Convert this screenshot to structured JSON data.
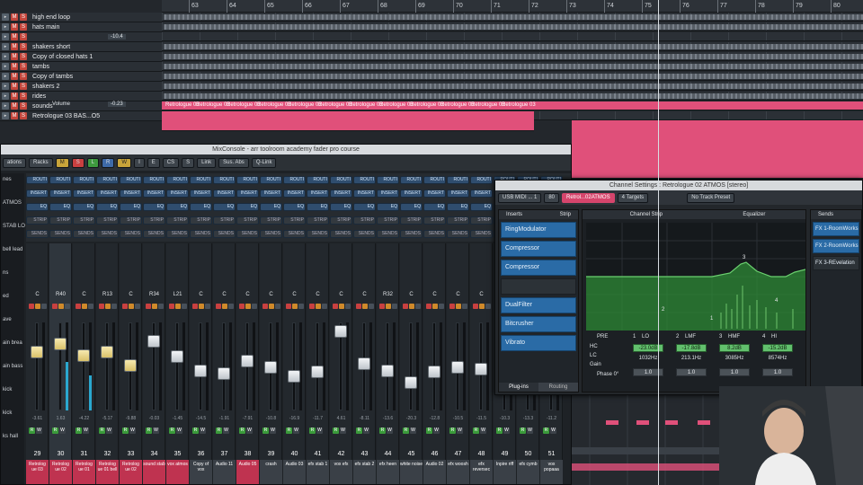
{
  "arrange": {
    "ruler_numbers": [
      "63",
      "64",
      "65",
      "66",
      "67",
      "68",
      "69",
      "70",
      "71",
      "72",
      "73",
      "74",
      "75",
      "76",
      "77",
      "78",
      "79",
      "80"
    ],
    "tracks": [
      {
        "name": "high end loop",
        "content": true
      },
      {
        "name": "hats main",
        "content": true
      },
      {
        "name": "",
        "content": false
      },
      {
        "name": "shakers short",
        "content": true
      },
      {
        "name": "Copy of closed hats 1",
        "content": true
      },
      {
        "name": "tambs",
        "content": true
      },
      {
        "name": "Copy of tambs",
        "content": true
      },
      {
        "name": "shakers 2",
        "content": true
      },
      {
        "name": "rides",
        "content": true
      },
      {
        "name": "sounds",
        "content": false
      },
      {
        "name": "Retrologue 03 BAS...O5",
        "content": false
      }
    ],
    "track_value_1": "-10.4",
    "track_value_2": "-0.23",
    "volume_label": "Volume",
    "part_label": "Retrologue 03"
  },
  "mixconsole": {
    "title": "MixConsole - arr toolroom academy fader pro course",
    "toolbar": [
      "ations",
      "Racks",
      "M",
      "S",
      "L",
      "R",
      "W",
      "I",
      "E",
      "CS",
      "S",
      "Link",
      "Sus. Abs",
      "Q-Link"
    ],
    "rack_rows": [
      "ROUTI",
      "INSERT",
      "EQ",
      "STRIP",
      "SENDS"
    ],
    "left_labels": [
      "nes",
      "ATMOS",
      "STAB LO",
      "bell lead",
      "ns",
      "ed",
      "ave",
      "ain brea",
      "ain bass",
      "kick",
      "kick",
      "ks hall"
    ],
    "strips": [
      {
        "label": "C",
        "num": "29",
        "name": "Retrolog ue 03",
        "val": "-3.61",
        "fader": 0.3,
        "meter": 0,
        "sel": false
      },
      {
        "label": "R40",
        "num": "30",
        "name": "Retrolog ue 02",
        "val": "1.63",
        "fader": 0.2,
        "meter": 0.55,
        "sel": true
      },
      {
        "label": "C",
        "num": "31",
        "name": "Retrolog ue 01",
        "val": "-4.22",
        "fader": 0.35,
        "meter": 0.4,
        "sel": false
      },
      {
        "label": "R13",
        "num": "32",
        "name": "Retrolog ue 01 bell",
        "val": "-5.17",
        "fader": 0.3,
        "meter": 0,
        "sel": false
      },
      {
        "label": "C",
        "num": "33",
        "name": "Retrolog ue 02",
        "val": "-9.88",
        "fader": 0.48,
        "meter": 0,
        "sel": false
      },
      {
        "label": "R34",
        "num": "34",
        "name": "sound stab",
        "val": "-0.03",
        "fader": 0.16,
        "meter": 0,
        "sel": false
      },
      {
        "label": "L21",
        "num": "35",
        "name": "vox atmos",
        "val": "-1.45",
        "fader": 0.36,
        "meter": 0,
        "sel": false
      },
      {
        "label": "C",
        "num": "36",
        "name": "Copy of vox",
        "val": "-14.5",
        "fader": 0.55,
        "meter": 0,
        "sel": false
      },
      {
        "label": "C",
        "num": "37",
        "name": "Audio 11",
        "val": "-1.91",
        "fader": 0.58,
        "meter": 0,
        "sel": false
      },
      {
        "label": "C",
        "num": "38",
        "name": "Audio 05",
        "val": "-7.91",
        "fader": 0.42,
        "meter": 0,
        "sel": false
      },
      {
        "label": "C",
        "num": "39",
        "name": "crash",
        "val": "-10.8",
        "fader": 0.5,
        "meter": 0,
        "sel": false
      },
      {
        "label": "C",
        "num": "40",
        "name": "Audio 03",
        "val": "-16.9",
        "fader": 0.62,
        "meter": 0,
        "sel": false
      },
      {
        "label": "C",
        "num": "41",
        "name": "efx stab 1",
        "val": "-11.7",
        "fader": 0.56,
        "meter": 0,
        "sel": false
      },
      {
        "label": "C",
        "num": "42",
        "name": "vox efx",
        "val": "4.61",
        "fader": 0.04,
        "meter": 0,
        "sel": false
      },
      {
        "label": "C",
        "num": "43",
        "name": "efx stab 2",
        "val": "-8.11",
        "fader": 0.45,
        "meter": 0,
        "sel": false
      },
      {
        "label": "R32",
        "num": "44",
        "name": "efx heen",
        "val": "-13.6",
        "fader": 0.55,
        "meter": 0,
        "sel": false
      },
      {
        "label": "C",
        "num": "45",
        "name": "white noise",
        "val": "-20.3",
        "fader": 0.7,
        "meter": 0,
        "sel": false
      },
      {
        "label": "C",
        "num": "46",
        "name": "Audio 02",
        "val": "-12.8",
        "fader": 0.56,
        "meter": 0,
        "sel": false
      },
      {
        "label": "C",
        "num": "47",
        "name": "efx woosh",
        "val": "-10.5",
        "fader": 0.5,
        "meter": 0,
        "sel": false
      },
      {
        "label": "C",
        "num": "48",
        "name": "efx reversec",
        "val": "-11.5",
        "fader": 0.52,
        "meter": 0,
        "sel": false
      },
      {
        "label": "C",
        "num": "49",
        "name": "Inpire riff",
        "val": "-10.3",
        "fader": 0.5,
        "meter": 0,
        "sel": false
      },
      {
        "label": "C",
        "num": "50",
        "name": "efx cymb",
        "val": "-13.3",
        "fader": 0.55,
        "meter": 0,
        "sel": false
      },
      {
        "label": "C",
        "num": "51",
        "name": "vox popaaa",
        "val": "-11.2",
        "fader": 0.52,
        "meter": 0,
        "sel": false
      }
    ]
  },
  "channel_settings": {
    "title": "Channel Settings : Retrologue 02 ATMOS [stereo]",
    "input": "USB MIDI ... 1",
    "channel_num": "80",
    "channel_name": "Retrol...02ATMOS",
    "targets": "4 Targets",
    "preset": "No Track Preset",
    "sections": {
      "inserts": "Inserts",
      "strip": "Strip",
      "channel_strip": "Channel Strip",
      "equalizer": "Equalizer",
      "sends": "Sends"
    },
    "inserts": [
      "RingModulator",
      "Compressor",
      "Compressor",
      "",
      "DualFilter",
      "Bitcrusher",
      "Vibrato"
    ],
    "tabs": {
      "plugins": "Plug-ins",
      "routing": "Routing"
    },
    "eq": {
      "pre": "PRE",
      "bands": [
        {
          "num": "1",
          "name": "LO",
          "gain": "-23.0dB",
          "freq": "1032Hz",
          "q": "1.0"
        },
        {
          "num": "2",
          "name": "LMF",
          "gain": "-17.8dB",
          "freq": "213.1Hz",
          "q": "1.0"
        },
        {
          "num": "3",
          "name": "HMF",
          "gain": "8.2dB",
          "freq": "3085Hz",
          "q": "1.0"
        },
        {
          "num": "4",
          "name": "HI",
          "gain": "-15.2dB",
          "freq": "8574Hz",
          "q": "1.0"
        }
      ],
      "hc": "HC",
      "lc": "LC",
      "gain_label": "Gain",
      "phase": "Phase 0°",
      "graph_labels": [
        "3",
        "2",
        "4",
        "1"
      ]
    },
    "sends": [
      "FX 1-RoomWorks",
      "FX 2-RoomWorks",
      "FX 3-REvelation"
    ]
  },
  "colors": {
    "accent_pink": "#e0507a",
    "insert_blue": "#2a6ba6",
    "eq_green": "#3bb04a"
  }
}
